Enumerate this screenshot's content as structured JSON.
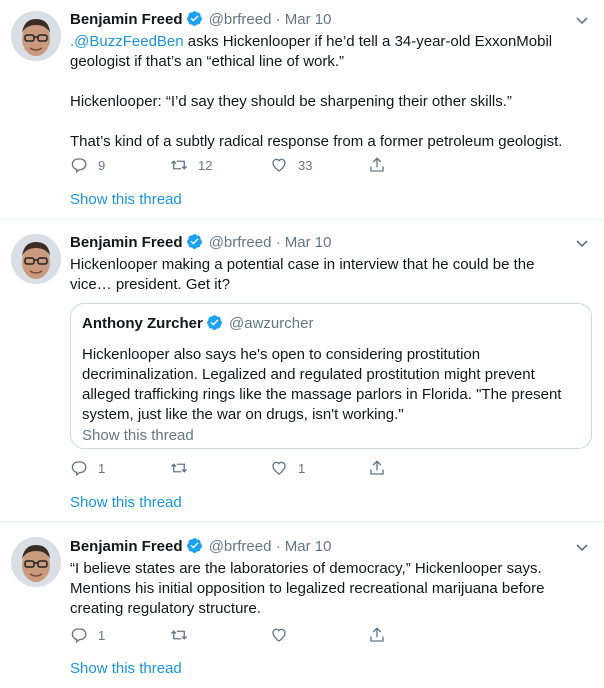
{
  "tweets": [
    {
      "author": "Benjamin Freed",
      "handle": "@brfreed",
      "date": "· Mar 10",
      "text_mention": ".@BuzzFeedBen",
      "text_line1": " asks Hickenlooper if he’d tell a 34-year-old ExxonMobil geologist if that’s an “ethical line of work.”",
      "text_line2": "Hickenlooper: “I’d say they should be sharpening their other skills.”",
      "text_line3": "That’s kind of a subtly radical response from a former petroleum geologist.",
      "replies": "9",
      "retweets": "12",
      "likes": "33",
      "show_thread": "Show this thread"
    },
    {
      "author": "Benjamin Freed",
      "handle": "@brfreed",
      "date": "· Mar 10",
      "text": "Hickenlooper making a potential case in interview that he could be the vice… president. Get it?",
      "quote": {
        "author": "Anthony Zurcher",
        "handle": "@awzurcher",
        "text": "Hickenlooper also says he's open to considering prostitution decriminalization. Legalized and regulated prostitution might prevent alleged trafficking rings like the massage parlors in Florida. \"The present system, just like the war on drugs, isn't working.\"",
        "show_thread": "Show this thread"
      },
      "replies": "1",
      "retweets": "",
      "likes": "1",
      "show_thread": "Show this thread"
    },
    {
      "author": "Benjamin Freed",
      "handle": "@brfreed",
      "date": "· Mar 10",
      "text": "“I believe states are the laboratories of democracy,” Hickenlooper says. Mentions his initial opposition to legalized recreational marijuana before creating regulatory structure.",
      "replies": "1",
      "retweets": "",
      "likes": "",
      "show_thread": "Show this thread"
    }
  ],
  "colors": {
    "link": "#1b95e0",
    "muted": "#657786",
    "verified": "#1da1f2",
    "border": "#e6ecf0"
  },
  "icons": [
    "reply-icon",
    "retweet-icon",
    "like-icon",
    "share-icon",
    "verified-icon",
    "chevron-down-icon"
  ]
}
